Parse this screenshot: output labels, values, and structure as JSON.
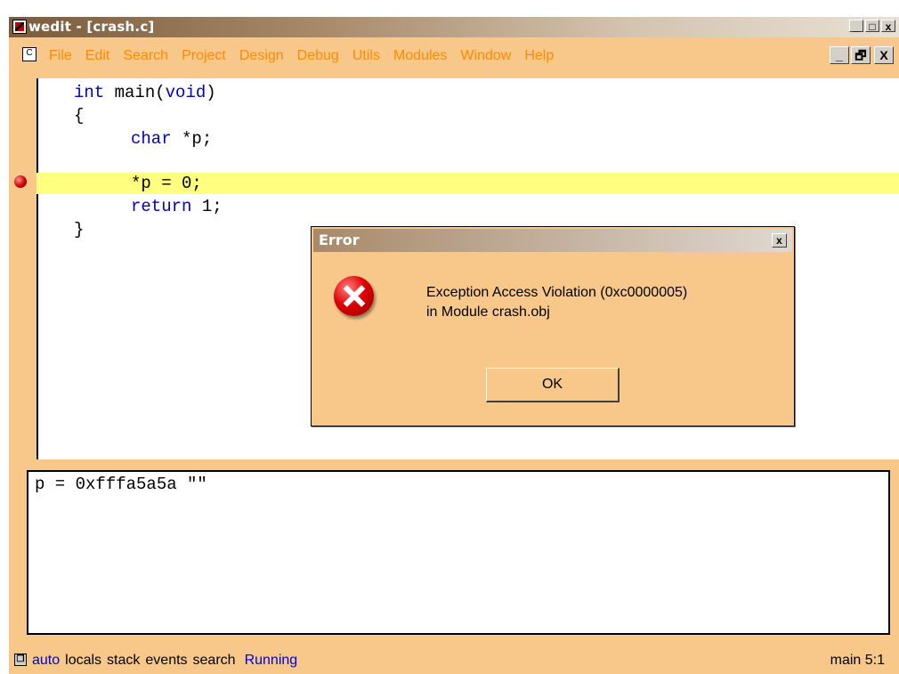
{
  "window": {
    "title": "wedit - [crash.c]",
    "caption_buttons": [
      "_",
      "□",
      "x"
    ]
  },
  "menu": {
    "items": [
      "File",
      "Edit",
      "Search",
      "Project",
      "Design",
      "Debug",
      "Utils",
      "Modules",
      "Window",
      "Help"
    ],
    "mdi_buttons": [
      "_",
      "🗗",
      "X"
    ],
    "color": "#ff8a00"
  },
  "editor": {
    "lines": [
      {
        "kw": "int",
        "rest": " main(",
        "kw2": "void",
        "tail": ")"
      },
      {
        "text": "{"
      },
      {
        "kw": "char",
        "rest": " *p;"
      },
      {
        "text": ""
      },
      {
        "text": "*p = 0;",
        "highlighted": true,
        "breakpoint": true
      },
      {
        "kw": "return",
        "rest": " 1;"
      },
      {
        "text": "}"
      }
    ],
    "highlight_color": "#ffff80",
    "keyword_color": "#0000c0"
  },
  "dialog": {
    "title": "Error",
    "close_label": "x",
    "icon": "error-icon",
    "message_line1": "Exception Access Violation (0xc0000005)",
    "message_line2": "in Module crash.obj",
    "ok_label": "OK"
  },
  "watch": {
    "text": "p = 0xfffa5a5a \"\""
  },
  "status": {
    "tabs": [
      "auto",
      "locals",
      "stack",
      "events",
      "search"
    ],
    "active_tab": "auto",
    "state": "Running",
    "position": "main 5:1"
  },
  "colors": {
    "background": "#f7c88a",
    "accent_blue": "#0000d0"
  }
}
